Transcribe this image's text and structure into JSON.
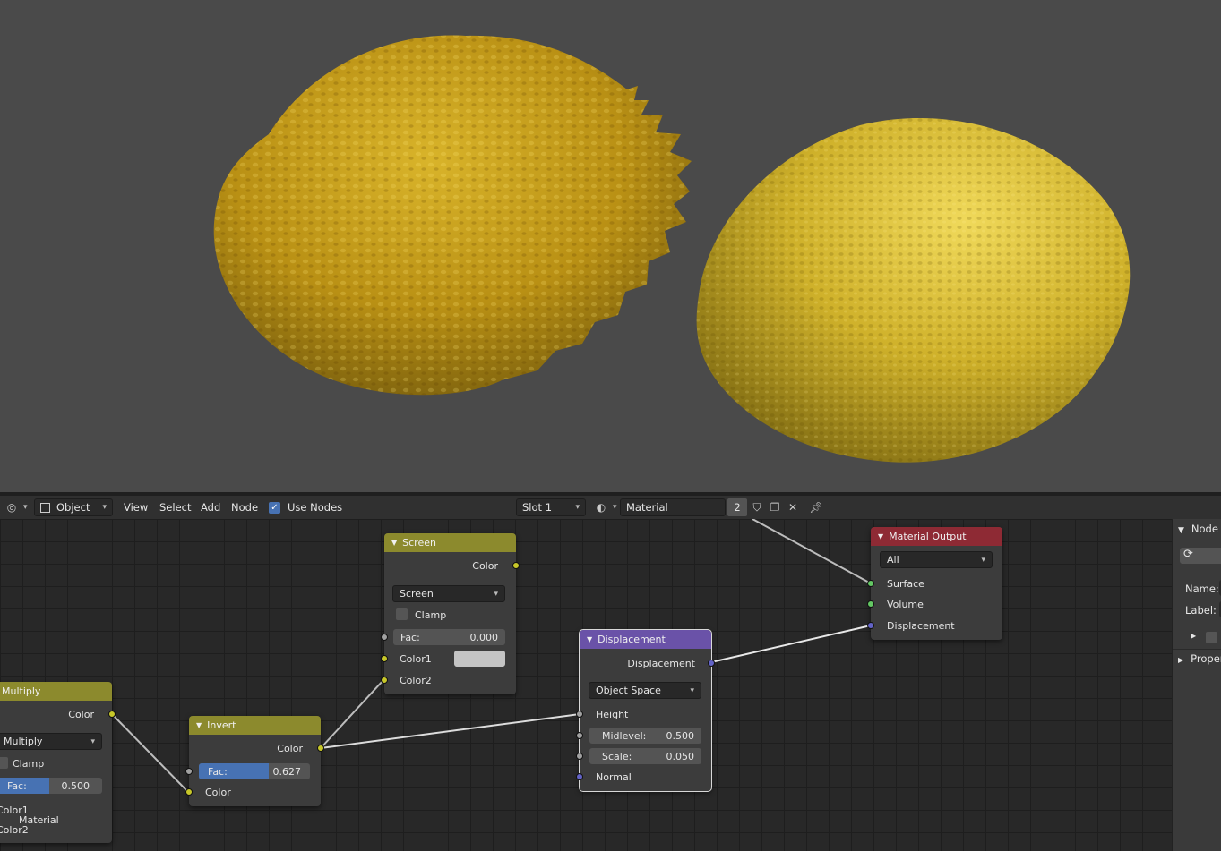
{
  "header": {
    "editor_type_icon": "shader-editor-icon",
    "object_mode": "Object",
    "menu": [
      "View",
      "Select",
      "Add",
      "Node"
    ],
    "use_nodes_label": "Use Nodes",
    "use_nodes_checked": true,
    "slot": "Slot 1",
    "material_name": "Material",
    "user_count": "2"
  },
  "nodes": {
    "multiply": {
      "title": "Multiply",
      "output": "Color",
      "blend_mode": "Multiply",
      "clamp_label": "Clamp",
      "fac_label": "Fac:",
      "fac_value": "0.500",
      "fac_fill": 0.5,
      "input1": "Color1",
      "input2": "Color2",
      "overlap_label": "Material"
    },
    "invert": {
      "title": "Invert",
      "output": "Color",
      "fac_label": "Fac:",
      "fac_value": "0.627",
      "fac_fill": 0.627,
      "input": "Color"
    },
    "screen": {
      "title": "Screen",
      "output": "Color",
      "blend_mode": "Screen",
      "clamp_label": "Clamp",
      "fac_label": "Fac:",
      "fac_value": "0.000",
      "input1": "Color1",
      "input2": "Color2",
      "color2_swatch": "#c4c4c4"
    },
    "displacement": {
      "title": "Displacement",
      "output": "Displacement",
      "space": "Object Space",
      "height_label": "Height",
      "midlevel_label": "Midlevel:",
      "midlevel_value": "0.500",
      "scale_label": "Scale:",
      "scale_value": "0.050",
      "normal_label": "Normal"
    },
    "material_output": {
      "title": "Material Output",
      "target": "All",
      "inputs": [
        "Surface",
        "Volume",
        "Displacement"
      ]
    }
  },
  "sidebar": {
    "panel_title": "Node",
    "name_label": "Name:",
    "label_label": "Label:",
    "properties_label": "Properties"
  },
  "colors": {
    "converter_header": "#8c8a2d",
    "vector_header": "#6a52a8",
    "output_header": "#8e2a34",
    "color_socket": "#c7c729",
    "float_socket": "#a1a1a1",
    "vector_socket": "#6363c7",
    "shader_socket": "#63c763"
  }
}
